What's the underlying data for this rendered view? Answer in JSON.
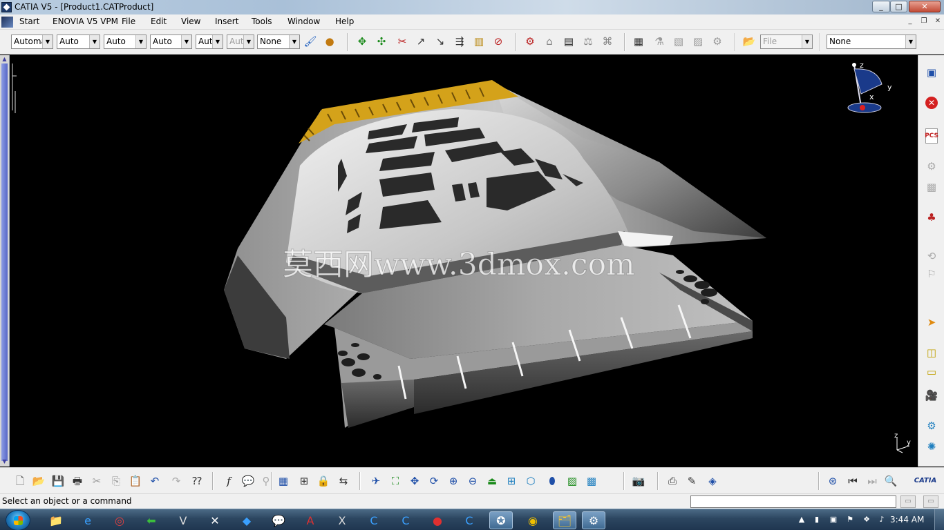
{
  "window": {
    "title": "CATIA V5 - [Product1.CATProduct]",
    "controls": {
      "minimize": "_",
      "maximize": "□",
      "close": "✕"
    }
  },
  "menubar": {
    "items": [
      "Start",
      "ENOVIA V5 VPM",
      "File",
      "Edit",
      "View",
      "Insert",
      "Tools",
      "Window",
      "Help"
    ],
    "mdi_controls": {
      "minimize": "_",
      "restore": "❐",
      "close": "✕"
    }
  },
  "toolbar_top": {
    "combos": [
      {
        "value": "Automatic",
        "enabled": true
      },
      {
        "value": "Auto",
        "enabled": true
      },
      {
        "value": "Auto",
        "enabled": true
      },
      {
        "value": "Auto",
        "enabled": true
      },
      {
        "value": "Auto",
        "enabled": true
      },
      {
        "value": "Auto",
        "enabled": false
      },
      {
        "value": "None",
        "enabled": true
      },
      {
        "value": "File",
        "enabled": false
      },
      {
        "value": "None",
        "enabled": true
      }
    ],
    "icons": [
      "painter-icon",
      "apply-material-icon",
      "move-icon",
      "rotate-manipulation-icon",
      "snap-icon",
      "explode-icon",
      "stop-manipulation-icon",
      "clash-icon",
      "sectioning-icon",
      "measure-icon",
      "catalog-browser-icon",
      "distance-analysis-icon",
      "bill-of-material-icon",
      "constraints-icon",
      "clash-detection-icon",
      "scenes-icon",
      "simulation-icon",
      "track-icon",
      "sequence-icon",
      "open-folder-icon"
    ],
    "combo_arrow": "▼"
  },
  "viewport": {
    "watermark": "莫西网www.3dmox.com",
    "compass_labels": {
      "z": "z",
      "y": "y",
      "x": "x"
    },
    "triad_labels": {
      "z": "z",
      "y": "y"
    },
    "colors": {
      "background": "#000000",
      "part_light": "#dcdcdc",
      "part_mid": "#9a9a9a",
      "part_dark": "#4a4a4a",
      "teeth": "#d4a21a"
    }
  },
  "toolbar_right": {
    "icons": [
      "desk-icon",
      "cancel-red-icon",
      "pcs-icon",
      "product-structure-icon",
      "insert-component-icon",
      "existing-component-icon",
      "replace-component-icon",
      "reorder-icon",
      "select-arrow-icon",
      "box-icon",
      "view-icon",
      "camera-icon",
      "fast-multi-instantiation-icon",
      "update-icon"
    ],
    "pcs_label": "PCS"
  },
  "toolbar_bottom": {
    "icons": [
      "new-icon",
      "open-icon",
      "save-icon",
      "print-icon",
      "cut-icon",
      "copy-icon",
      "paste-icon",
      "undo-icon",
      "redo-icon",
      "whats-this-icon",
      "formula-icon",
      "knowledge-icon",
      "knowledge-advisor-icon",
      "catalog-icon",
      "tree-icon",
      "lock-icon",
      "pan-tree-icon",
      "fly-mode-icon",
      "fit-all-icon",
      "pan-icon",
      "rotate-icon",
      "zoom-in-icon",
      "zoom-out-icon",
      "normal-view-icon",
      "multi-view-icon",
      "iso-view-icon",
      "shading-icon",
      "hide-show-icon",
      "swap-visible-space-icon",
      "capture-icon",
      "publish-icon",
      "edit-links-icon",
      "scan-icon",
      "target-icon",
      "first-icon",
      "last-icon",
      "search-icon"
    ],
    "brand": "CATIA"
  },
  "statusbar": {
    "text": "Select an object or a command"
  },
  "taskbar": {
    "icons": [
      "explorer-icon",
      "ie-icon",
      "snagit-icon",
      "green-arrow-icon",
      "vpn-icon",
      "pinyin-icon",
      "box-app-icon",
      "chat-icon",
      "acrobat-icon",
      "x-app-icon",
      "c-app-icon-1",
      "c-app-icon-2",
      "media-icon",
      "c-app-icon-3",
      "catia-task-icon",
      "chrome-icon",
      "folder-task-icon",
      "catia-v5-task-icon"
    ],
    "clock": "3:44 AM"
  }
}
